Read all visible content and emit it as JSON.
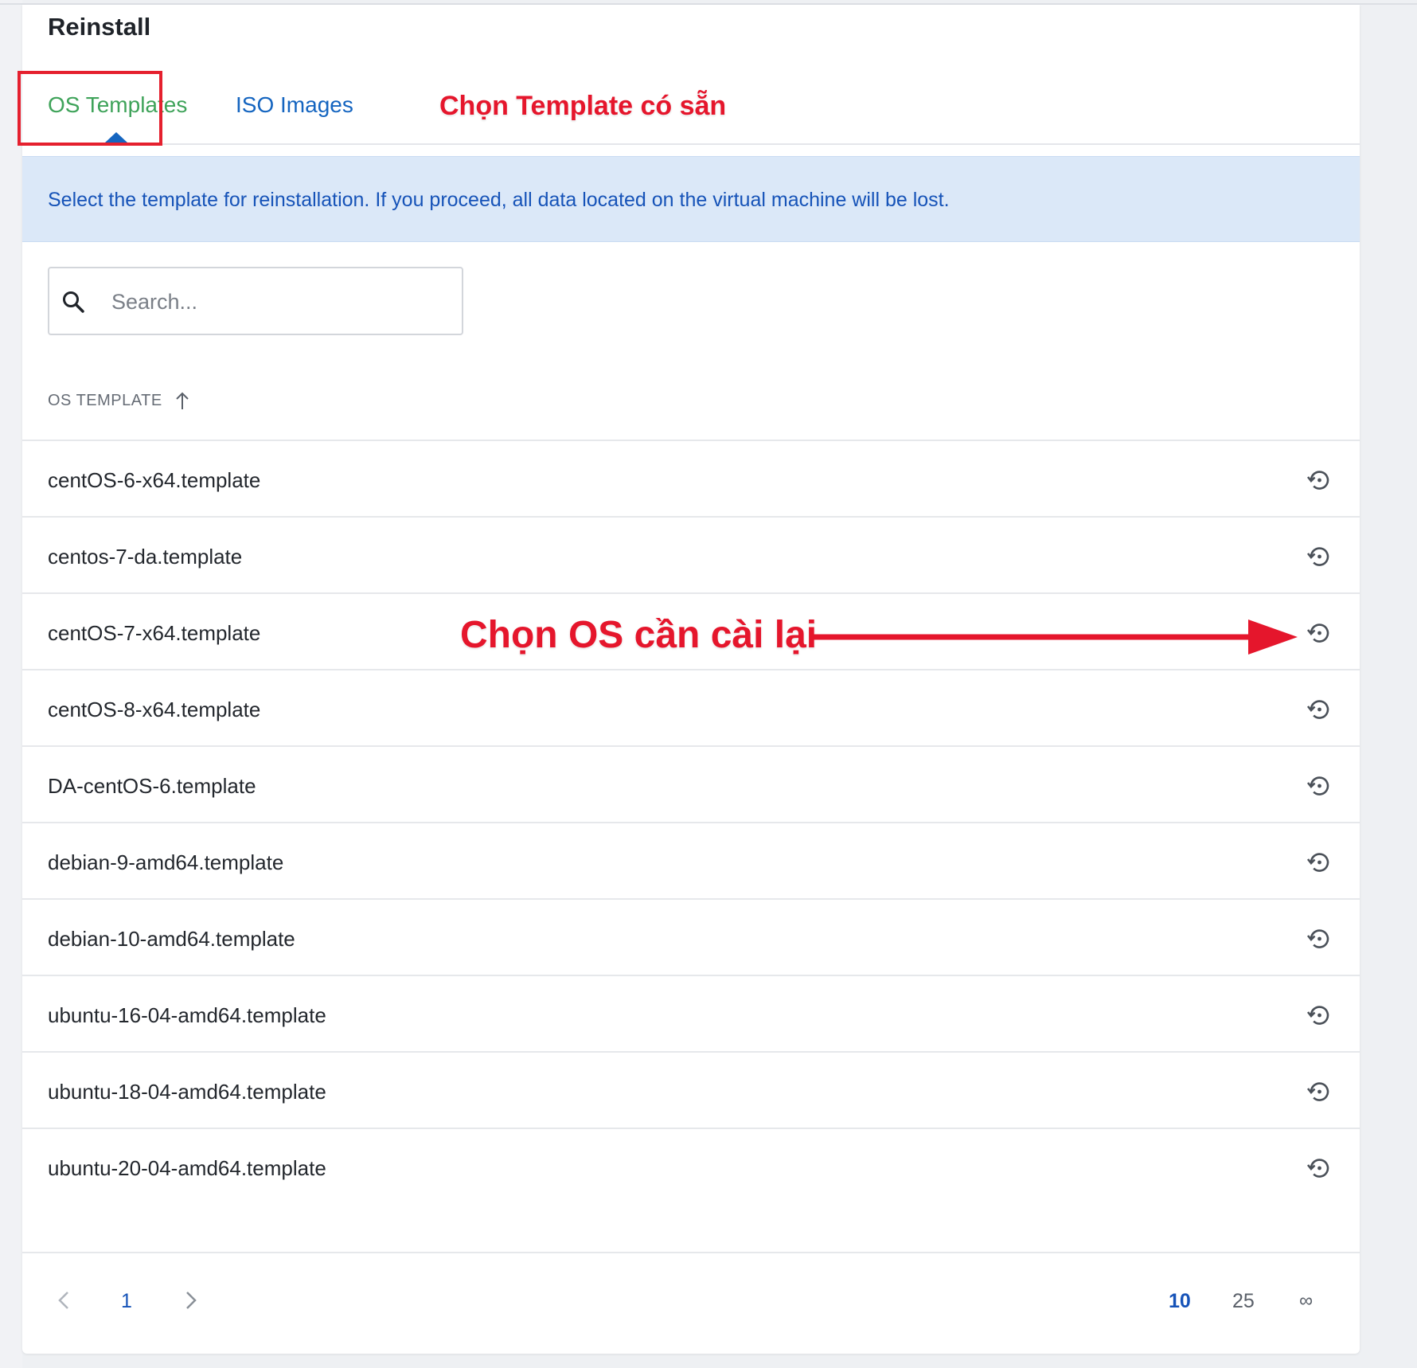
{
  "header": {
    "title": "Reinstall"
  },
  "tabs": [
    {
      "label": "OS Templates",
      "active": true
    },
    {
      "label": "ISO Images",
      "active": false
    }
  ],
  "annotations": {
    "tab_note": "Chọn Template có sẵn",
    "row_note": "Chọn OS cần cài lại"
  },
  "info_banner": "Select the template for reinstallation. If you proceed, all data located on the virtual machine will be lost.",
  "search": {
    "placeholder": "Search...",
    "value": "",
    "icon": "search-icon"
  },
  "table": {
    "column_header": "OS TEMPLATE",
    "sort": "ascending",
    "rows": [
      {
        "name": "centOS-6-x64.template"
      },
      {
        "name": "centos-7-da.template"
      },
      {
        "name": "centOS-7-x64.template"
      },
      {
        "name": "centOS-8-x64.template"
      },
      {
        "name": "DA-centOS-6.template"
      },
      {
        "name": "debian-9-amd64.template"
      },
      {
        "name": "debian-10-amd64.template"
      },
      {
        "name": "ubuntu-16-04-amd64.template"
      },
      {
        "name": "ubuntu-18-04-amd64.template"
      },
      {
        "name": "ubuntu-20-04-amd64.template"
      }
    ],
    "row_action_icon": "restore-icon"
  },
  "pagination": {
    "current_page": "1",
    "page_sizes": [
      "10",
      "25",
      "∞"
    ],
    "selected_page_size": "10"
  },
  "colors": {
    "active_tab": "#3fa35a",
    "link": "#1565c0",
    "annotation": "#e5162c",
    "info_bg": "#dbe8f8"
  }
}
